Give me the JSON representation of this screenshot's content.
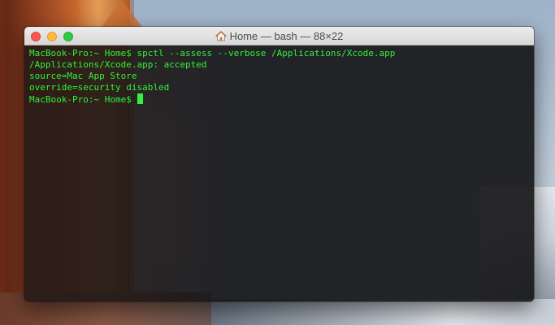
{
  "window": {
    "title": "Home — bash — 88×22",
    "icons": {
      "title_icon": "home-icon",
      "close": "close-icon",
      "minimize": "minimize-icon",
      "zoom": "zoom-icon"
    }
  },
  "terminal": {
    "lines": [
      "MacBook-Pro:~ Home$ spctl --assess --verbose /Applications/Xcode.app",
      "/Applications/Xcode.app: accepted",
      "source=Mac App Store",
      "override=security disabled",
      "MacBook-Pro:~ Home$ "
    ],
    "text_color": "#2ff23a",
    "background_color": "#161618"
  },
  "colors": {
    "close": "#fc5753",
    "minimize": "#fdbc40",
    "zoom": "#34c84a"
  }
}
